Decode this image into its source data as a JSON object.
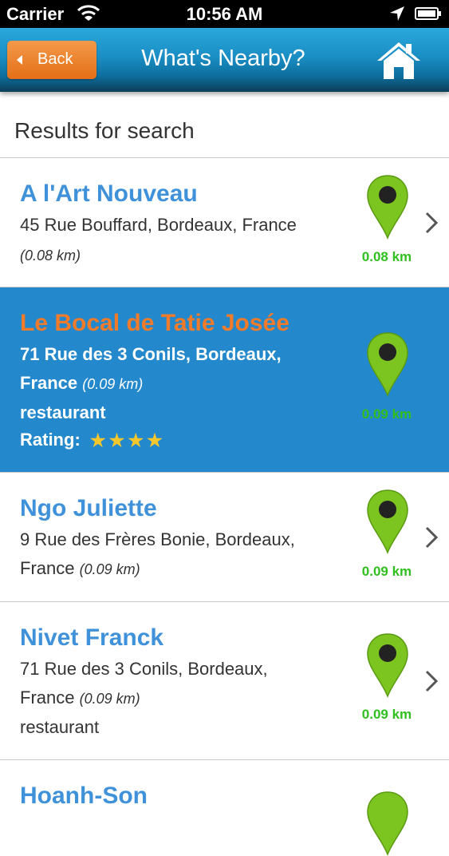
{
  "status": {
    "carrier": "Carrier",
    "time": "10:56 AM"
  },
  "nav": {
    "back_label": "Back",
    "title": "What's Nearby?"
  },
  "section": {
    "header": "Results for search"
  },
  "colors": {
    "accent": "#2488cc",
    "name": "#3f92d9",
    "selected_name": "#f07b2b",
    "distance": "#2fbf1e",
    "back_button": "#e97a22"
  },
  "results": [
    {
      "name": "A l'Art Nouveau",
      "address1": "45 Rue Bouffard, Bordeaux, France",
      "distance_inline": "(0.08 km)",
      "distance": "0.08 km"
    },
    {
      "name": "Le Bocal de Tatie Josée",
      "address1": "71 Rue des 3 Conils, Bordeaux,",
      "address2": "France",
      "distance_inline": "(0.09 km)",
      "type": "restaurant",
      "rating_label": "Rating:",
      "rating": 4,
      "distance": "0.09 km"
    },
    {
      "name": "Ngo Juliette",
      "address1": "9 Rue des Frères Bonie, Bordeaux,",
      "address2": "France",
      "distance_inline": "(0.09 km)",
      "distance": "0.09 km"
    },
    {
      "name": "Nivet Franck",
      "address1": "71 Rue des 3 Conils, Bordeaux,",
      "address2": "France",
      "distance_inline": "(0.09 km)",
      "type": "restaurant",
      "distance": "0.09 km"
    },
    {
      "name": "Hoanh-Son"
    }
  ]
}
